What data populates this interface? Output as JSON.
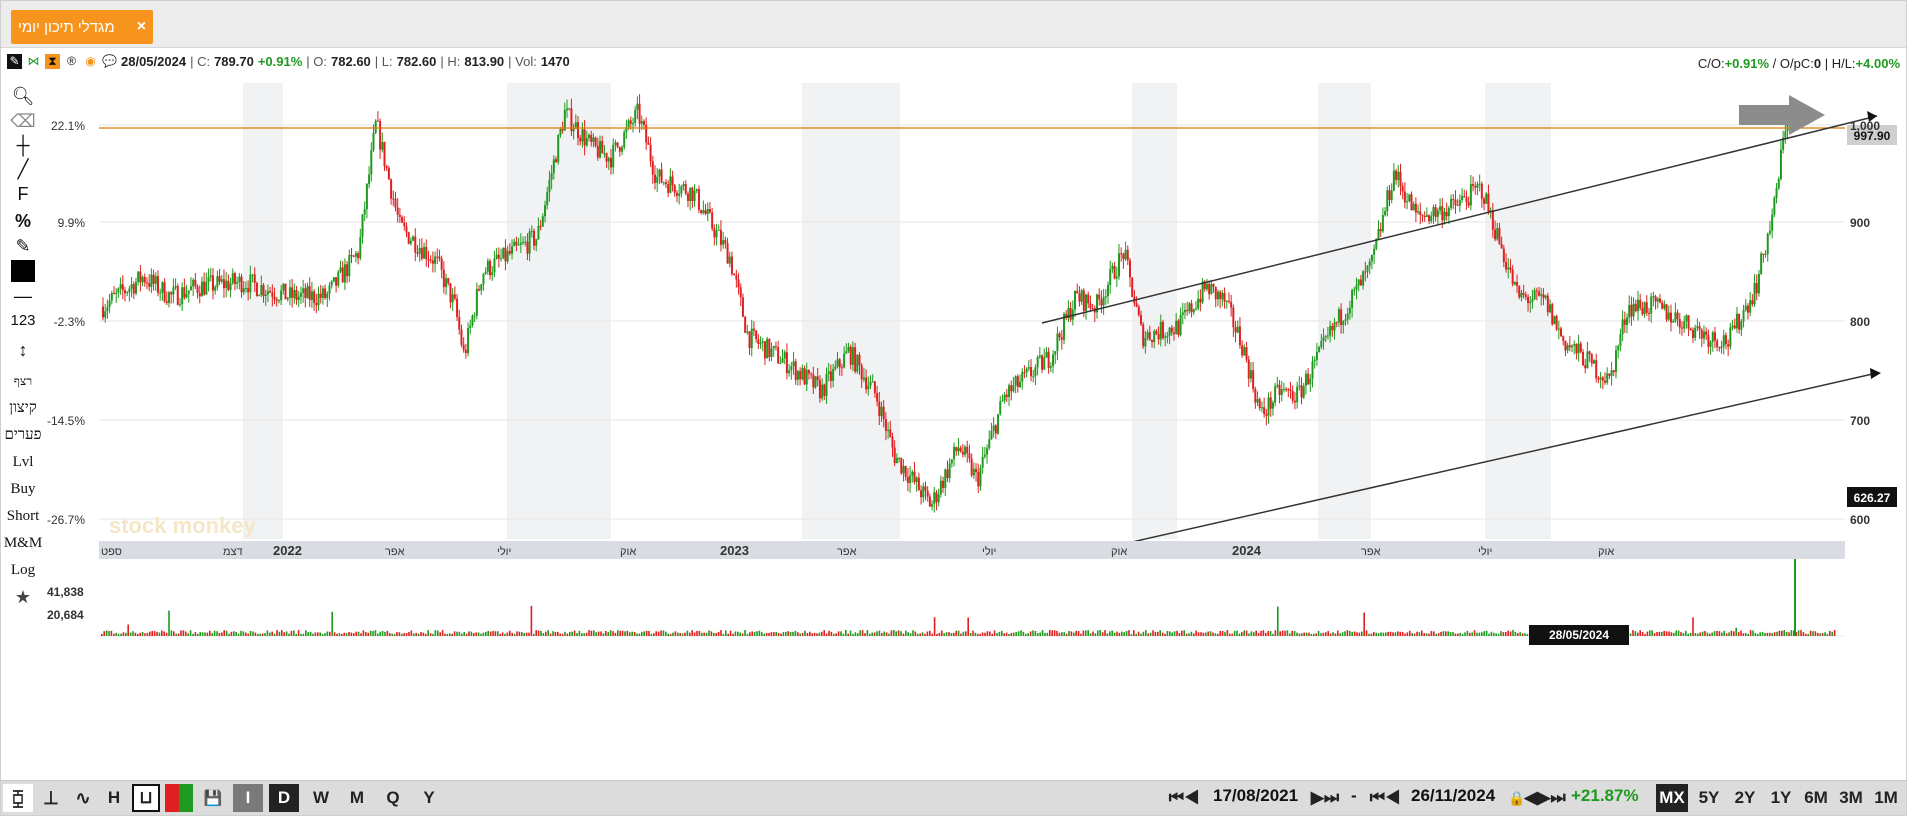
{
  "tab": {
    "title": "מגדלי תיכון יומי",
    "close": "×"
  },
  "quote": {
    "date": "28/05/2024",
    "close_label": "| C:",
    "close": "789.70",
    "change": "+0.91%",
    "open_label": "| O:",
    "open": "782.60",
    "low_label": "| L:",
    "low": "782.60",
    "high_label": "| H:",
    "high": "813.90",
    "vol_label": "| Vol:",
    "vol": "1470",
    "co_label": "C/O:",
    "co": "+0.91%",
    "opc_label": "/ O/pC:",
    "opc": "0",
    "hl_label": "| H/L:",
    "hl": "+4.00%"
  },
  "toolbar_left": [
    "search-icon",
    "eraser-icon",
    "crosshair-icon",
    "pencil-icon",
    "F",
    "%",
    "edit-icon",
    "color-swatch",
    "line-width",
    "123",
    "vertical-size",
    "candle-icon",
    "רצף",
    "קיצון",
    "פערים",
    "Lvl",
    "Buy",
    "Short",
    "M&M",
    "Log",
    "star-icon"
  ],
  "tools_text": {
    "f": "F",
    "pct": "%",
    "num": "123",
    "rezef": "רצף",
    "kitzun": "קיצון",
    "paarim": "פערים",
    "lvl": "Lvl",
    "buy": "Buy",
    "short": "Short",
    "mm": "M&M",
    "log": "Log"
  },
  "axis": {
    "left_pct": [
      "22.1%",
      "9.9%",
      "-2.3%",
      "-14.5%",
      "-26.7%"
    ],
    "right_price": [
      "1,000",
      "900",
      "800",
      "700",
      "600"
    ],
    "x_labels": [
      "ספט",
      "דצמ",
      "2022",
      "אפר",
      "יולי",
      "אוק",
      "2023",
      "אפר",
      "יולי",
      "אוק",
      "2024",
      "אפר",
      "יולי",
      "אוק"
    ],
    "last_price": "997.90",
    "low_price": "626.27",
    "volume_ticks": [
      "41,838",
      "20,684"
    ],
    "cursor_date": "28/05/2024"
  },
  "watermark": "stock monkey",
  "colors": {
    "up": "#1e9a1e",
    "down": "#e02020",
    "accent": "#f7941d",
    "hline": "#e07b00"
  },
  "bottom": {
    "chart_types": [
      "candles",
      "bars",
      "line",
      "H",
      "U",
      "heikin"
    ],
    "periods": [
      "I",
      "D",
      "W",
      "M",
      "Q",
      "Y"
    ],
    "active_period": "D",
    "from_date": "17/08/2021",
    "to_date": "26/11/2024",
    "range_change": "+21.87%",
    "zoom": [
      "MX",
      "5Y",
      "2Y",
      "1Y",
      "6M",
      "3M",
      "1M"
    ],
    "active_zoom": "MX",
    "dash": "-"
  }
}
